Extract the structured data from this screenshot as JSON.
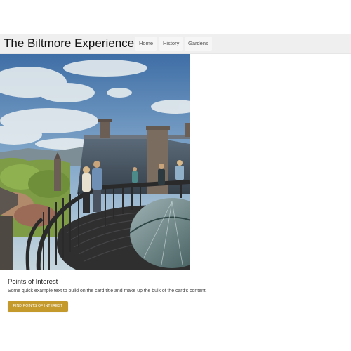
{
  "navbar": {
    "brand": "The Biltmore Experience",
    "items": [
      {
        "label": "Home"
      },
      {
        "label": "History"
      },
      {
        "label": "Gardens"
      }
    ]
  },
  "card": {
    "image_subject": "rooftop-observation-deck-photo",
    "title": "Points of Interest",
    "text": "Some quick example text to build on the card title and make up the bulk of the card's content.",
    "button_label": "FIND POINTS OF INTEREST"
  },
  "colors": {
    "navbar_bg": "#efefef",
    "button_bg": "#c49a2c"
  }
}
